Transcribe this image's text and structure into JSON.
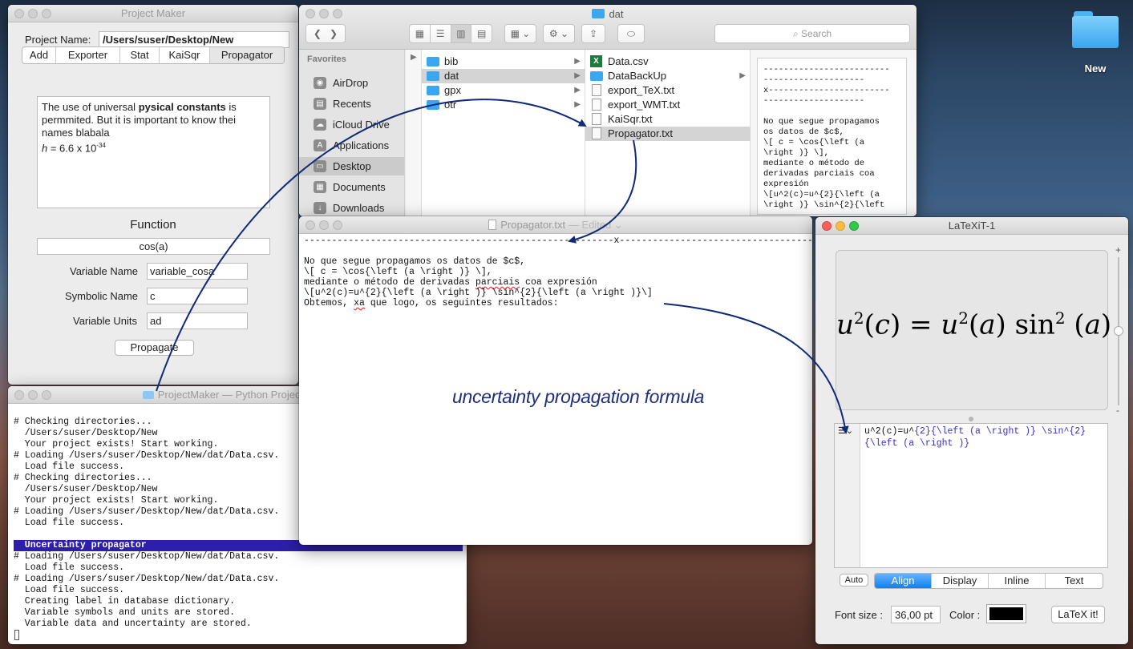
{
  "desktop": {
    "folder_label": "New"
  },
  "project_maker": {
    "title": "Project Maker",
    "project_name_label": "Project Name:",
    "project_name_value": "/Users/suser/Desktop/New",
    "tabs": [
      "Add",
      "Exporter",
      "Stat",
      "KaiSqr",
      "Propagator"
    ],
    "description": {
      "p1_before": "The use of universal ",
      "p1_bold": "pysical constants",
      "p1_after": " is permmited. But it is important to know thei names blabala",
      "h_symbol": "h",
      "h_value": " = 6.6 x 10",
      "h_exp": "-34"
    },
    "function_label": "Function",
    "function_value": "cos(a)",
    "variable_name_label": "Variable Name",
    "variable_name_value": "variable_cosa",
    "symbolic_name_label": "Symbolic Name",
    "symbolic_name_value": "c",
    "variable_units_label": "Variable Units",
    "variable_units_value": "ad",
    "propagate_button": "Propagate"
  },
  "finder": {
    "title": "dat",
    "search_placeholder": "Search",
    "favorites_header": "Favorites",
    "sidebar": [
      {
        "label": "AirDrop",
        "icon": "airdrop-icon",
        "glyph": "◉"
      },
      {
        "label": "Recents",
        "icon": "recents-icon",
        "glyph": "▤"
      },
      {
        "label": "iCloud Drive",
        "icon": "cloud-icon",
        "glyph": "☁"
      },
      {
        "label": "Applications",
        "icon": "applications-icon",
        "glyph": "A"
      },
      {
        "label": "Desktop",
        "icon": "desktop-icon",
        "glyph": "▭"
      },
      {
        "label": "Documents",
        "icon": "documents-icon",
        "glyph": "▦"
      },
      {
        "label": "Downloads",
        "icon": "downloads-icon",
        "glyph": "↓"
      }
    ],
    "column1": [
      "bib",
      "dat",
      "gpx",
      "otr"
    ],
    "column2": [
      "Data.csv",
      "DataBackUp",
      "export_TeX.txt",
      "export_WMT.txt",
      "KaiSqr.txt",
      "Propagator.txt"
    ],
    "preview": "-------------------------\n--------------------\nx------------------------\n--------------------\n\nNo que segue propagamos\nos datos de $c$,\n\\[ c = \\cos{\\left (a\n\\right )} \\],\nmediante o método de\nderivadas parciais coa\nexpresión\n\\[u^2(c)=u^{2}{\\left (a\n\\right )} \\sin^{2}{\\left"
  },
  "editor": {
    "title": "Propagator.txt",
    "title_suffix": "— Edited ⌄",
    "line1": "--------------------------------------------------------x---------------------------------------------------",
    "line2": "",
    "line3": "No que segue propagamos os datos de $c$,",
    "line4": "\\[ c = \\cos{\\left (a \\right )} \\],",
    "line5_a": "mediante o método de derivadas ",
    "line5_b": "parciais",
    "line5_c": " coa expresión",
    "line6": "\\[u^2(c)=u^{2}{\\left (a \\right )} \\sin^{2}{\\left (a \\right )}\\]",
    "line7_a": "Obtemos, ",
    "line7_b": "xa",
    "line7_c": " que logo, os seguintes resultados:"
  },
  "annotation": "uncertainty propagation formula",
  "log": {
    "title": "ProjectMaker — Python ProjectMaker",
    "lines": [
      "# Checking directories...",
      "  /Users/suser/Desktop/New",
      "  Your project exists! Start working.",
      "# Loading /Users/suser/Desktop/New/dat/Data.csv.",
      "  Load file success.",
      "# Checking directories...",
      "  /Users/suser/Desktop/New",
      "  Your project exists! Start working.",
      "# Loading /Users/suser/Desktop/New/dat/Data.csv.",
      "  Load file success.",
      "",
      "  Uncertainty propagator",
      "# Loading /Users/suser/Desktop/New/dat/Data.csv.",
      "  Load file success.",
      "# Loading /Users/suser/Desktop/New/dat/Data.csv.",
      "  Load file success.",
      "  Creating label in database dictionary.",
      "  Variable symbols and units are stored.",
      "  Variable data and uncertainty are stored."
    ],
    "highlight_index": 11
  },
  "latexit": {
    "title": "LaTeXiT-1",
    "source_plain": "u^2(c)=u^",
    "source_colored_1": "{2}{\\left (a \\right )} \\sin^{2}",
    "source_colored_2": "{\\left (a \\right )}",
    "auto_button": "Auto",
    "modes": [
      "Align",
      "Display",
      "Inline",
      "Text"
    ],
    "selected_mode": "Align",
    "font_size_label": "Font size :",
    "font_size_value": "36,00 pt",
    "color_label": "Color :",
    "color_value": "#000000",
    "latex_button": "LaTeX it!",
    "zoom_plus": "+",
    "zoom_minus": "-"
  },
  "colors": {
    "arrow": "#102a7a",
    "highlight": "#2d1fa9",
    "accent": "#0d81f2"
  }
}
